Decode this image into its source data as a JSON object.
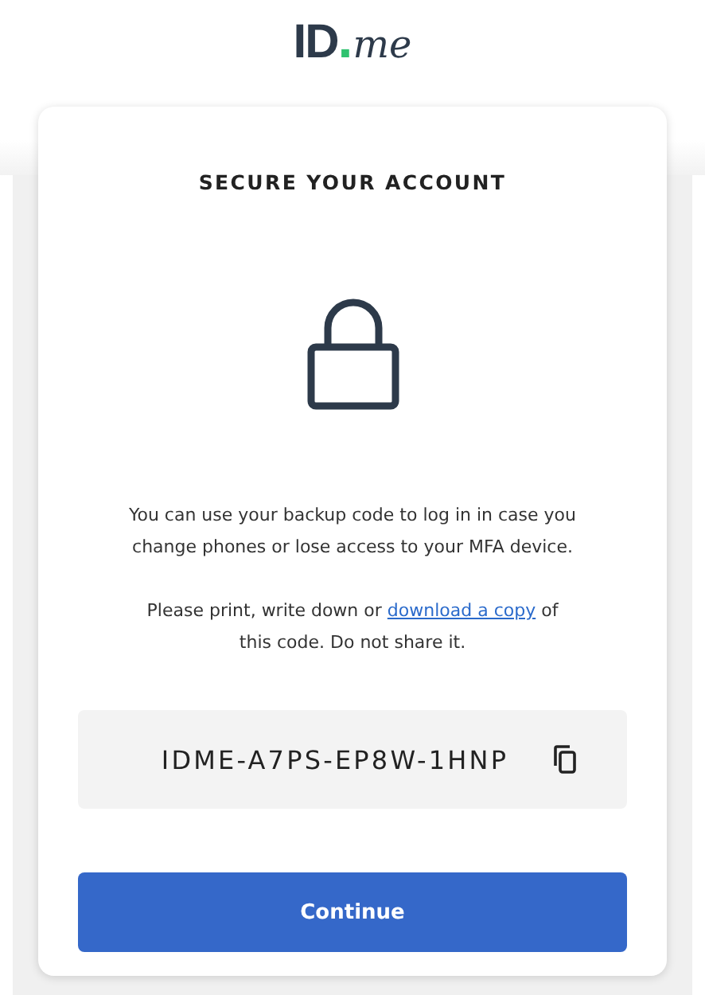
{
  "logo": {
    "main": "ID",
    "dot": ".",
    "suffix": "me"
  },
  "card": {
    "title": "SECURE YOUR ACCOUNT",
    "intro": "You can use your backup code to log in in case you change phones or lose access to your MFA device.",
    "instruction": {
      "before": "Please print, write down or",
      "link": "download a copy",
      "after": "of this code. Do not share it."
    },
    "backup_code": "IDME-A7PS-EP8W-1HNP",
    "button": "Continue"
  }
}
